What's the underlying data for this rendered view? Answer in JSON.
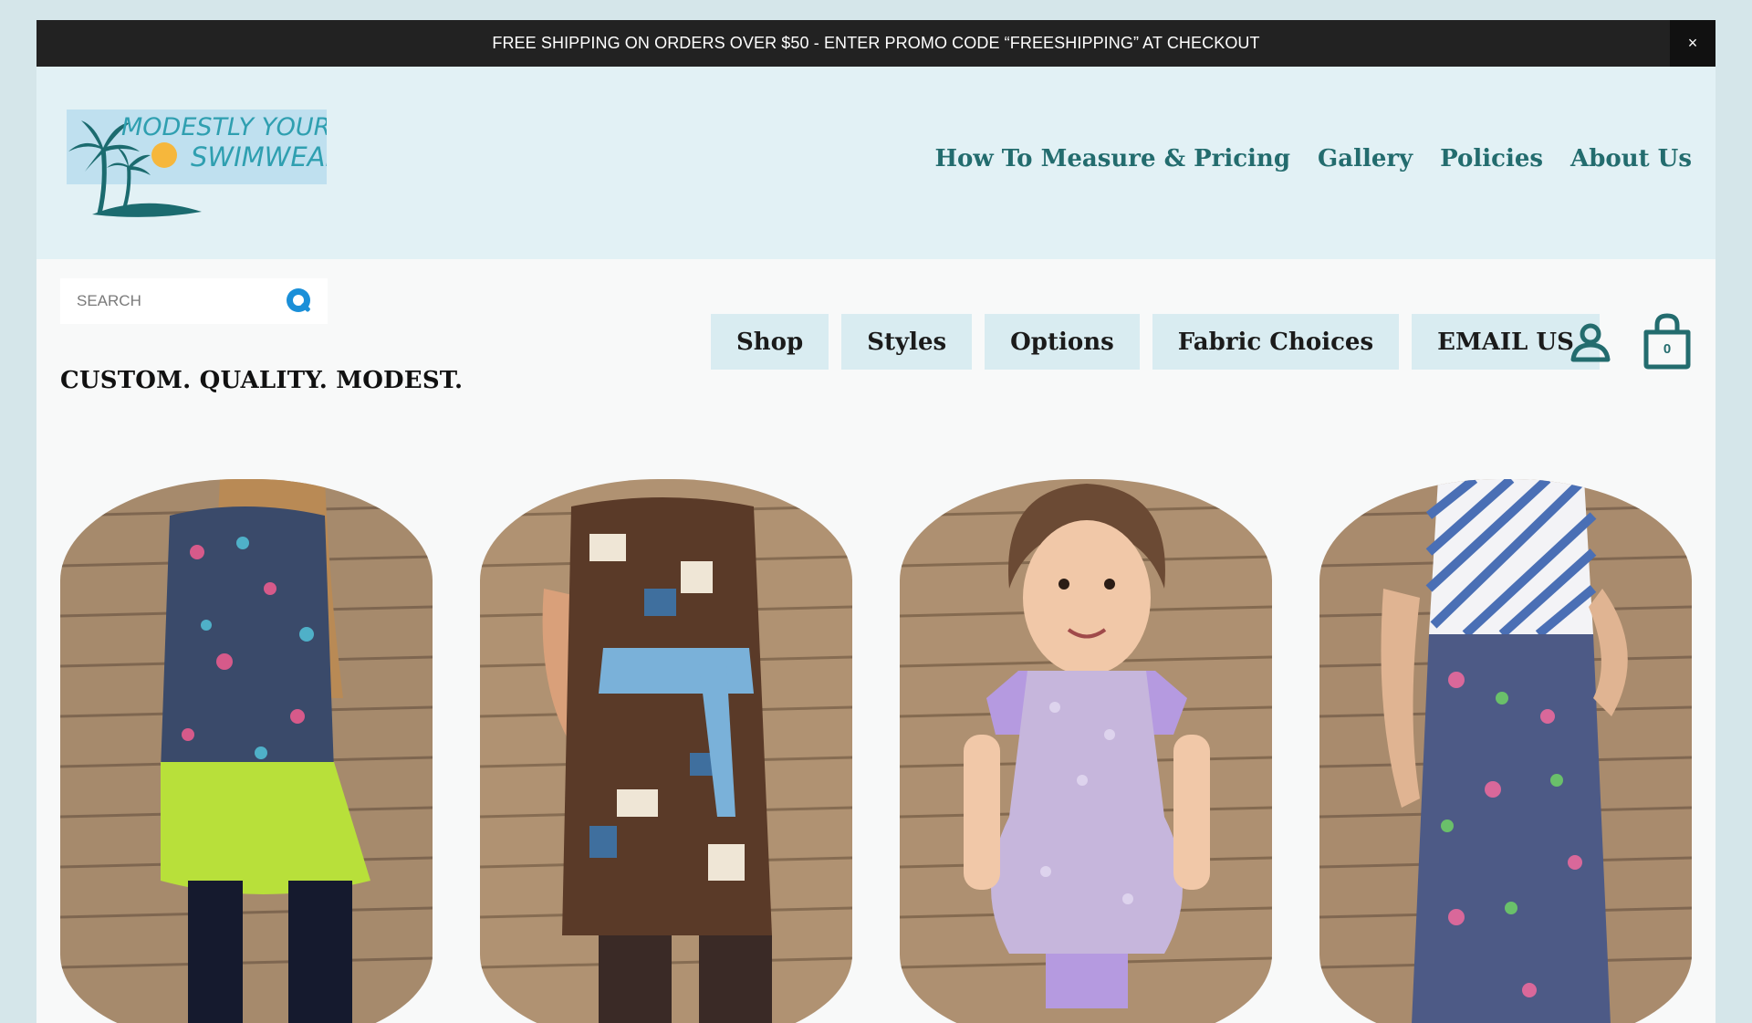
{
  "announcement": {
    "text": "FREE SHIPPING ON ORDERS OVER $50 - ENTER PROMO CODE “FREESHIPPING” AT CHECKOUT",
    "close_label": "×"
  },
  "logo": {
    "line1": "MODESTLY YOURS",
    "line2": "SWIMWEAR"
  },
  "top_nav": [
    {
      "label": "How To Measure & Pricing"
    },
    {
      "label": "Gallery"
    },
    {
      "label": "Policies"
    },
    {
      "label": "About Us"
    }
  ],
  "search": {
    "placeholder": "SEARCH",
    "icon": "search-icon"
  },
  "tagline": "CUSTOM. QUALITY. MODEST.",
  "main_nav": [
    {
      "label": "Shop"
    },
    {
      "label": "Styles"
    },
    {
      "label": "Options"
    },
    {
      "label": "Fabric Choices"
    },
    {
      "label": "EMAIL US"
    }
  ],
  "account": {
    "icon": "user-icon"
  },
  "cart": {
    "icon": "shopping-bag-icon",
    "count": "0"
  },
  "colors": {
    "brand_teal": "#236c6e",
    "header_bg": "#e2f1f5",
    "nav_button_bg": "#d9ecf1",
    "announcement_bg": "#222222",
    "search_icon": "#1a8fd8"
  },
  "gallery": [
    {
      "subject": "floral top with lime skirt"
    },
    {
      "subject": "patterned tunic with blue sash"
    },
    {
      "subject": "child in lavender sequin dress"
    },
    {
      "subject": "striped and floral maxi dress"
    }
  ]
}
